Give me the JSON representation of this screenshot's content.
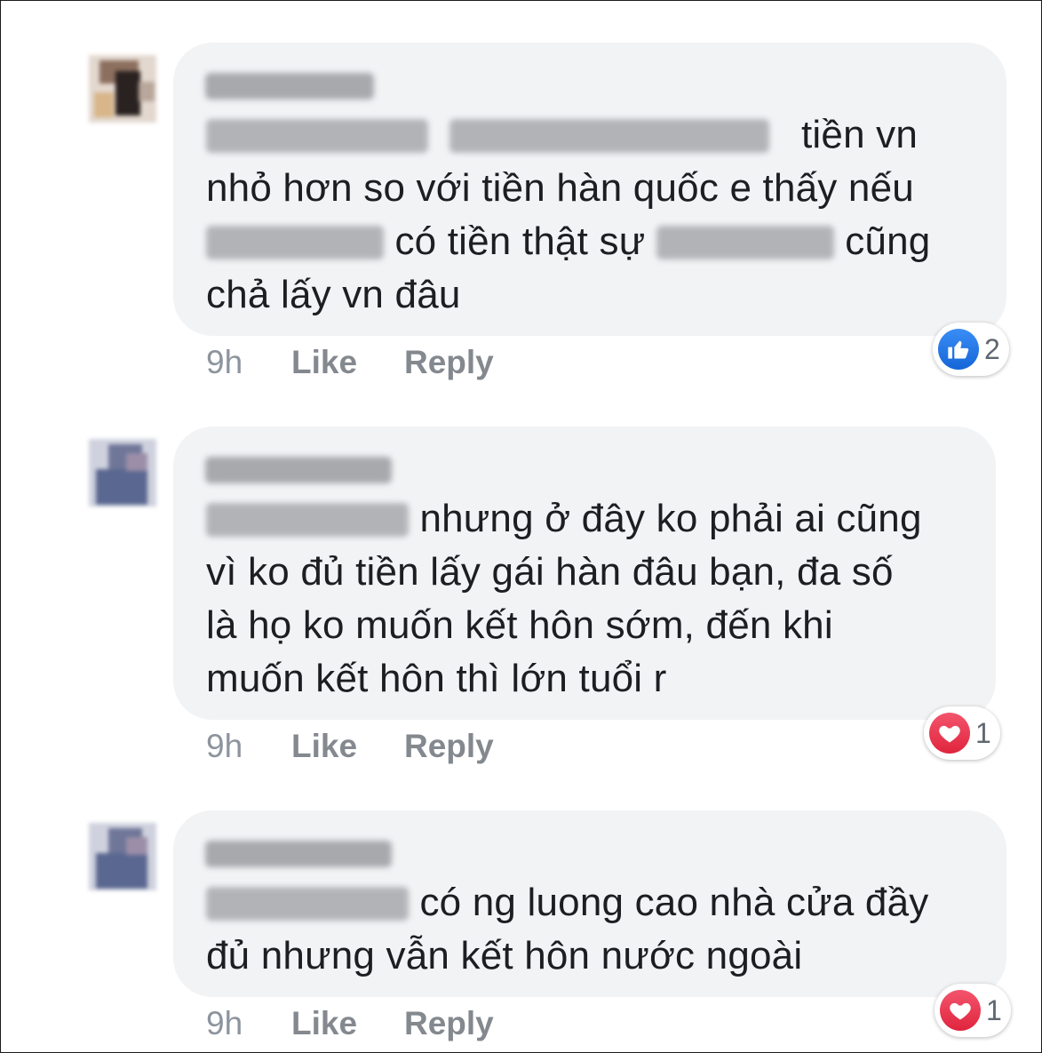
{
  "comments": [
    {
      "segments": [
        "tiền vn",
        "nhỏ hơn so với tiền hàn quốc e thấy nếu",
        "có tiền thật sự",
        "cũng",
        "chả lấy vn đâu"
      ],
      "time": "9h",
      "like_label": "Like",
      "reply_label": "Reply",
      "reaction": {
        "type": "like",
        "icon": "thumbs-up-icon",
        "count": "2",
        "color": "#1877f2"
      }
    },
    {
      "segments": [
        "nhưng ở đây ko phải ai cũng",
        "vì ko đủ tiền lấy gái hàn đâu bạn, đa số",
        "là họ ko muốn kết hôn sớm, đến khi",
        "muốn kết hôn thì lớn tuổi r"
      ],
      "time": "9h",
      "like_label": "Like",
      "reply_label": "Reply",
      "reaction": {
        "type": "love",
        "icon": "heart-icon",
        "count": "1",
        "color": "#f33e58"
      }
    },
    {
      "segments": [
        "có ng luong cao nhà cửa đầy",
        "đủ nhưng vẫn kết hôn nước ngoài"
      ],
      "time": "9h",
      "like_label": "Like",
      "reply_label": "Reply",
      "reaction": {
        "type": "love",
        "icon": "heart-icon",
        "count": "1",
        "color": "#f33e58"
      }
    }
  ]
}
